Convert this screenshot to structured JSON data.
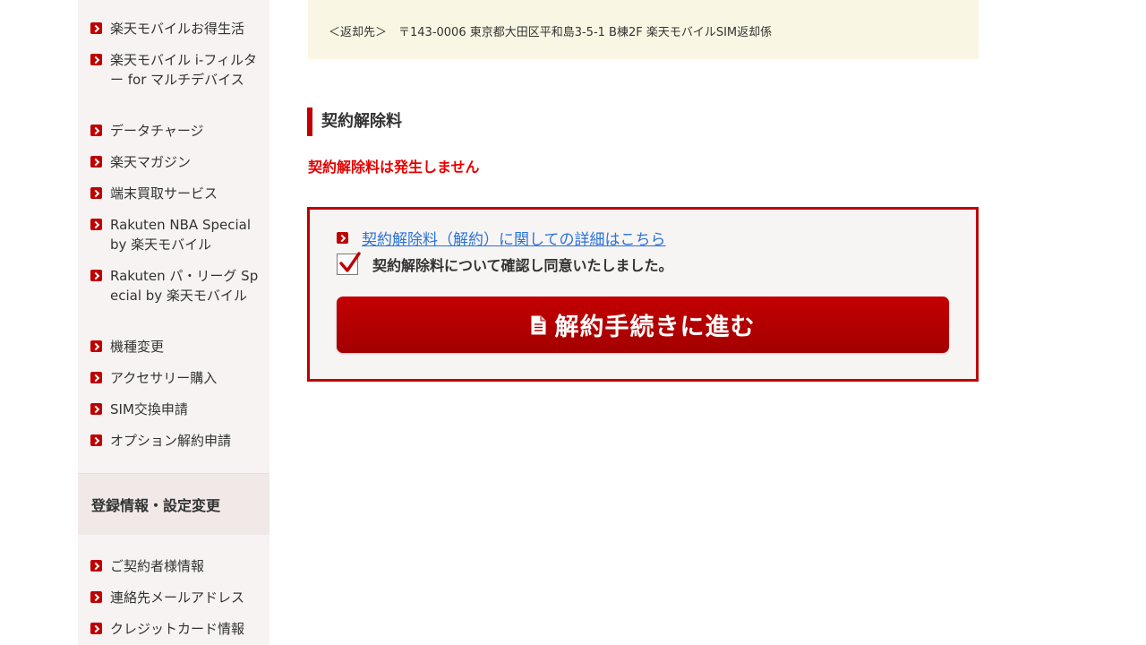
{
  "sidebar": {
    "items_top": [
      {
        "label": "楽天モバイルお得生活"
      },
      {
        "label": "楽天モバイル i-フィルター for マルチデバイス"
      },
      {
        "label": "データチャージ"
      },
      {
        "label": "楽天マガジン"
      },
      {
        "label": "端末買取サービス"
      },
      {
        "label": "Rakuten NBA Special by 楽天モバイル"
      },
      {
        "label": "Rakuten パ・リーグ Special by 楽天モバイル"
      },
      {
        "label": "機種変更"
      },
      {
        "label": "アクセサリー購入"
      },
      {
        "label": "SIM交換申請"
      },
      {
        "label": "オプション解約申請"
      }
    ],
    "section_header": "登録情報・設定変更",
    "items_bottom": [
      {
        "label": "ご契約者様情報"
      },
      {
        "label": "連絡先メールアドレス"
      },
      {
        "label": "クレジットカード情報"
      }
    ]
  },
  "main": {
    "return_address": "＜返却先＞　〒143-0006 東京都大田区平和島3-5-1 B棟2F 楽天モバイルSIM返却係",
    "section_title": "契約解除料",
    "no_fee_notice": "契約解除料は発生しません",
    "detail_link": "契約解除料（解約）に関しての詳細はこちら",
    "agree_label": "契約解除料について確認し同意いたしました。",
    "agree_checked": true,
    "proceed_button": "解約手続きに進む",
    "icons": {
      "arrow": "chevron-right-icon",
      "document": "document-icon",
      "check": "check-icon"
    },
    "colors": {
      "accent": "#bf0000",
      "notice": "#e60000",
      "link": "#2a73d9",
      "address_bg": "#f9f7e3"
    }
  }
}
